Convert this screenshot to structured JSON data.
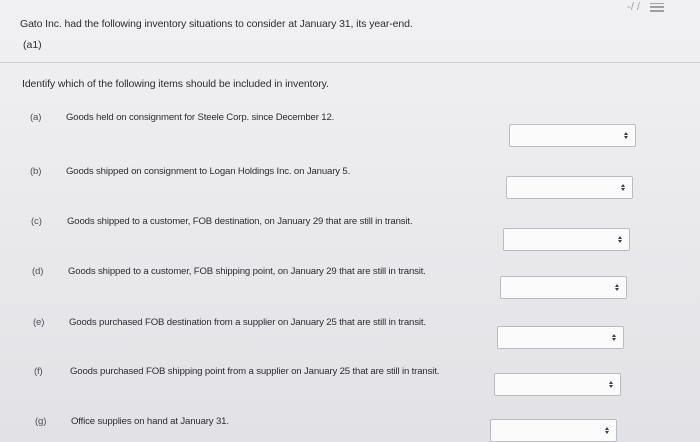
{
  "question": {
    "prompt": "Gato Inc. had the following inventory situations to consider at January 31, its year-end.",
    "part_label": "(a1)",
    "instruction": "Identify which of the following items should be included in inventory."
  },
  "items": [
    {
      "letter": "(a)",
      "text": "Goods held on consignment for Steele Corp. since December 12.",
      "selected": ""
    },
    {
      "letter": "(b)",
      "text": "Goods shipped on consignment to Logan Holdings Inc. on January 5.",
      "selected": ""
    },
    {
      "letter": "(c)",
      "text": "Goods shipped to a customer, FOB destination, on January 29 that are still in transit.",
      "selected": ""
    },
    {
      "letter": "(d)",
      "text": "Goods shipped to a customer, FOB shipping point, on January 29 that are still in transit.",
      "selected": ""
    },
    {
      "letter": "(e)",
      "text": "Goods purchased FOB destination from a supplier on January 25 that are still in transit.",
      "selected": ""
    },
    {
      "letter": "(f)",
      "text": "Goods purchased FOB shipping point from a supplier on January 25 that are still in transit.",
      "selected": ""
    },
    {
      "letter": "(g)",
      "text": "Office supplies on hand at January 31.",
      "selected": ""
    }
  ],
  "icons": {
    "top_left": "collapse-icon",
    "top_right": "menu-icon",
    "dropdown": "chevron-updown-icon"
  },
  "colors": {
    "background": "#ebebee",
    "text": "#2a2d33",
    "select_border": "#b9bcc3"
  }
}
